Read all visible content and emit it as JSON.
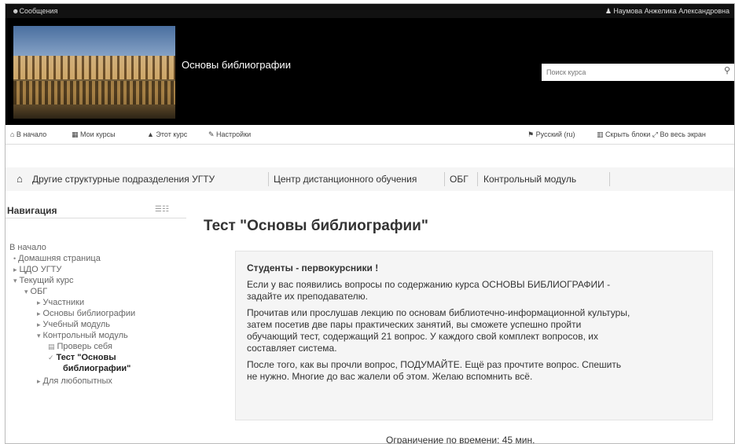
{
  "topbar": {
    "messages": "☻Сообщения",
    "user": "♟ Наумова Анжелика Александровна"
  },
  "header": {
    "site_title": "Основы библиографии",
    "search_placeholder": "Поиск курса"
  },
  "navbar": [
    {
      "label": "⌂ В начало"
    },
    {
      "label": "▦ Мои курсы"
    },
    {
      "label": "▲ Этот курс"
    },
    {
      "label": "✎ Настройки"
    },
    {
      "label": "⚑ Русский (ru)"
    },
    {
      "label": "▥ Скрыть блоки ⤢ Во весь экран"
    }
  ],
  "breadcrumb": {
    "home_icon": "home-icon",
    "items": [
      "Другие структурные подразделения УГТУ",
      "Центр дистанционного обучения",
      "ОБГ",
      "Контрольный модуль"
    ]
  },
  "sidebar": {
    "title": "Навигация",
    "menu_glyph": "☰☷",
    "items": [
      {
        "marker": "",
        "label": "В начало"
      },
      {
        "marker": "•",
        "label": "Домашняя страница"
      },
      {
        "marker": "▸",
        "label": "ЦДО УГТУ"
      },
      {
        "marker": "▾",
        "label": "Текущий курс"
      },
      {
        "marker": "▾",
        "label": "ОБГ"
      },
      {
        "marker": "▸",
        "label": "Участники"
      },
      {
        "marker": "▸",
        "label": "Основы библиографии"
      },
      {
        "marker": "▸",
        "label": "Учебный модуль"
      },
      {
        "marker": "▾",
        "label": "Контрольный модуль"
      },
      {
        "marker": "▤",
        "label": "Проверь себя"
      },
      {
        "marker": "✓",
        "label": "Тест \"Основы"
      },
      {
        "marker": "",
        "label": "библиографии\""
      },
      {
        "marker": "▸",
        "label": "Для любопытных"
      }
    ]
  },
  "main": {
    "title": "Тест \"Основы библиографии\"",
    "intro": {
      "heading": "Студенты - первокурсники !",
      "lines": [
        "Если у вас появились вопросы по содержанию курса ОСНОВЫ БИБЛИОГРАФИИ -",
        "задайте их преподавателю.",
        "Прочитав или прослушав лекцию по основам библиотечно-информационной культуры,",
        "затем посетив две пары практических занятий, вы сможете успешно пройти",
        "обучающий тест, содержащий 21 вопрос. У каждого свой комплект вопросов, их",
        "составляет система.",
        "После того, как вы прочли вопрос, ПОДУМАЙТЕ. Ещё раз прочтите вопрос. Спешить",
        "не нужно. Многие до вас жалели об этом. Желаю вспомнить всё."
      ]
    },
    "time_limit": "Ограничение по времени: 45 мин."
  }
}
